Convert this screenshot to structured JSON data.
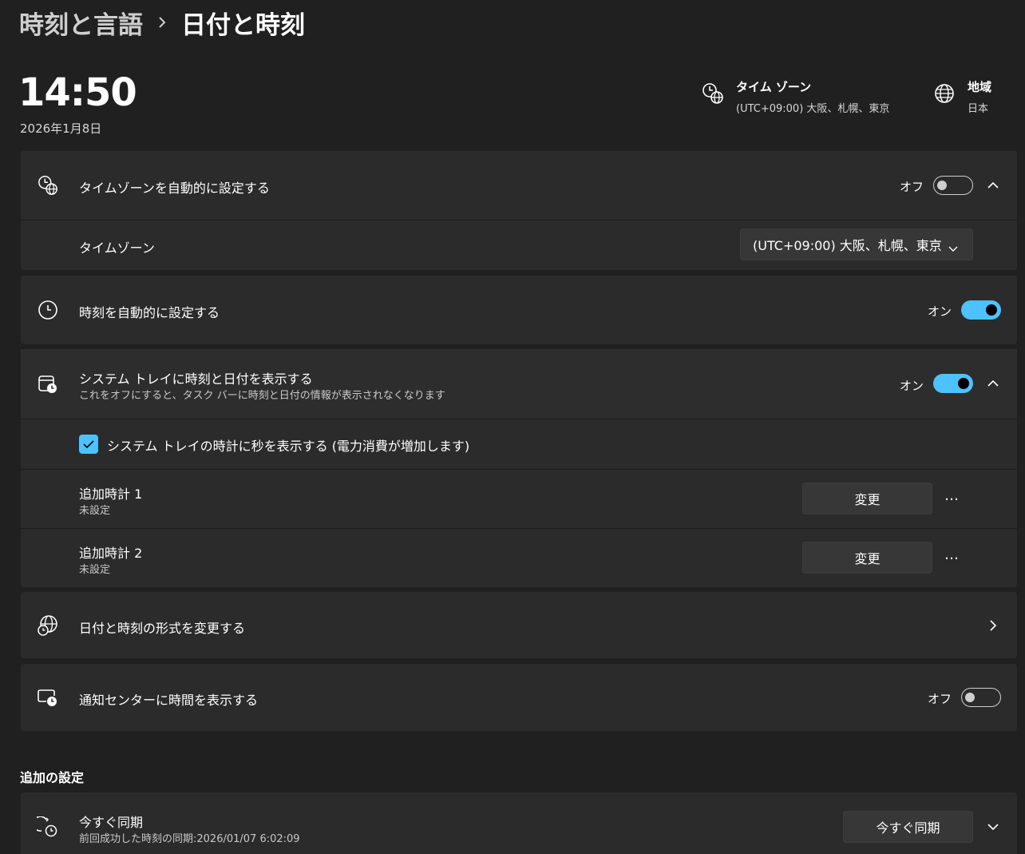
{
  "breadcrumb": {
    "parent": "時刻と言語",
    "separator": "›",
    "current": "日付と時刻"
  },
  "clock": {
    "time": "14:50",
    "date": "2026年1月8日"
  },
  "info": {
    "timezone": {
      "title": "タイム ゾーン",
      "value": "(UTC+09:00) 大阪、札幌、東京"
    },
    "region": {
      "title": "地域",
      "value": "日本"
    }
  },
  "settings": {
    "auto_timezone": {
      "label": "タイムゾーンを自動的に設定する",
      "state_label": "オフ",
      "on": false
    },
    "timezone_select": {
      "label": "タイムゾーン",
      "value": "(UTC+09:00) 大阪、札幌、東京"
    },
    "auto_time": {
      "label": "時刻を自動的に設定する",
      "state_label": "オン",
      "on": true
    },
    "systray": {
      "label": "システム トレイに時刻と日付を表示する",
      "description": "これをオフにすると、タスク バーに時刻と日付の情報が表示されなくなります",
      "state_label": "オン",
      "on": true
    },
    "show_seconds": {
      "label": "システム トレイの時計に秒を表示する (電力消費が増加します)",
      "checked": true
    },
    "clock1": {
      "label": "追加時計 1",
      "sub": "未設定",
      "button": "変更",
      "more": "…"
    },
    "clock2": {
      "label": "追加時計 2",
      "sub": "未設定",
      "button": "変更",
      "more": "…"
    },
    "format": {
      "label": "日付と時刻の形式を変更する"
    },
    "notification": {
      "label": "通知センターに時間を表示する",
      "state_label": "オフ",
      "on": false
    }
  },
  "additional": {
    "title": "追加の設定",
    "sync": {
      "label": "今すぐ同期",
      "sub": "前回成功した時刻の同期:2026/01/07 6:02:09",
      "button": "今すぐ同期"
    }
  },
  "colors": {
    "accent": "#4cc2ff",
    "background": "#202020",
    "card": "#2b2b2b"
  }
}
